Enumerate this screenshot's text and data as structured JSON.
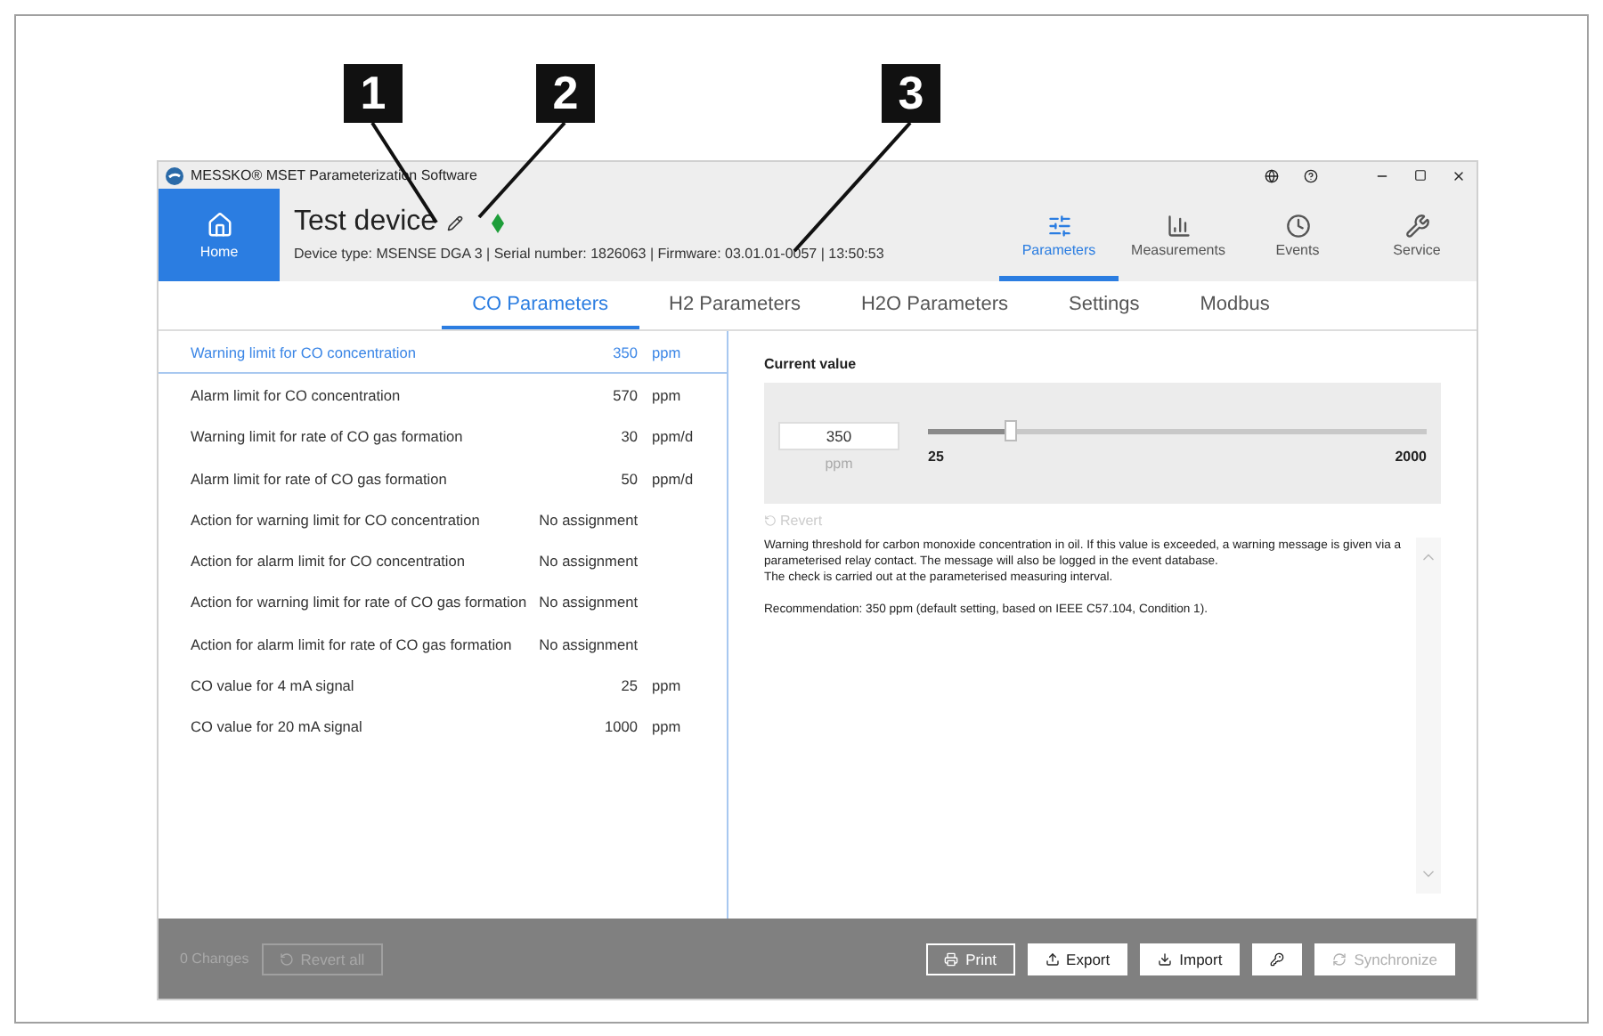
{
  "callouts": [
    {
      "number": "1"
    },
    {
      "number": "2"
    },
    {
      "number": "3"
    }
  ],
  "window": {
    "title": "MESSKO® MSET Parameterization Software"
  },
  "home": {
    "label": "Home",
    "selected": true
  },
  "device": {
    "name": "Test device",
    "info": "Device type: MSENSE DGA 3 | Serial number: 1826063 | Firmware: 03.01.01-0057 | 13:50:53"
  },
  "nav": [
    {
      "label": "Parameters",
      "selected": true
    },
    {
      "label": "Measurements",
      "selected": false
    },
    {
      "label": "Events",
      "selected": false
    },
    {
      "label": "Service",
      "selected": false
    }
  ],
  "tabs": [
    {
      "label": "CO Parameters",
      "selected": true
    },
    {
      "label": "H2 Parameters",
      "selected": false
    },
    {
      "label": "H2O Parameters",
      "selected": false
    },
    {
      "label": "Settings",
      "selected": false
    },
    {
      "label": "Modbus",
      "selected": false
    }
  ],
  "parameters": [
    {
      "name": "Warning limit for CO concentration",
      "value": "350",
      "unit": "ppm",
      "selected": true
    },
    {
      "name": "Alarm limit for CO concentration",
      "value": "570",
      "unit": "ppm",
      "selected": false
    },
    {
      "name": "Warning limit for rate of CO gas formation",
      "value": "30",
      "unit": "ppm/d",
      "selected": false
    },
    {
      "name": "Alarm limit for rate of CO gas formation",
      "value": "50",
      "unit": "ppm/d",
      "selected": false
    },
    {
      "name": "Action for warning limit for CO concentration",
      "value": "No assignment",
      "selected": false
    },
    {
      "name": "Action for alarm limit for CO concentration",
      "value": "No assignment",
      "selected": false
    },
    {
      "name": "Action for warning limit for rate of CO gas formation",
      "value": "No assignment",
      "selected": false
    },
    {
      "name": "Action for alarm limit for rate of CO gas formation",
      "value": "No assignment",
      "selected": false
    },
    {
      "name": "CO value for 4 mA signal",
      "value": "25",
      "unit": "ppm",
      "selected": false
    },
    {
      "name": "CO value for 20 mA signal",
      "value": "1000",
      "unit": "ppm",
      "selected": false
    }
  ],
  "current_value": {
    "heading": "Current value",
    "value": "350",
    "unit": "ppm",
    "min": "25",
    "max": "2000",
    "level": 0.165,
    "revert": {
      "label": "Revert",
      "disabled": true
    }
  },
  "description": [
    "Warning threshold for carbon monoxide concentration in oil. If this value is exceeded, a warning message is given via a parameterised relay contact. The message will also be logged in the event database.",
    "The check is carried out at the parameterised measuring interval.",
    "Recommendation: 350 ppm (default setting, based on IEEE C57.104, Condition 1)."
  ],
  "footer": {
    "changes": "0 Changes",
    "revert_all": {
      "label": "Revert all",
      "disabled": true
    },
    "buttons": [
      {
        "label": "Print",
        "kind": "outline",
        "disabled": false
      },
      {
        "label": "Export",
        "kind": "solid",
        "disabled": false
      },
      {
        "label": "Import",
        "kind": "solid",
        "disabled": false
      },
      {
        "kind": "solid",
        "disabled": false
      },
      {
        "label": "Synchronize",
        "kind": "solid",
        "disabled": true
      }
    ]
  }
}
